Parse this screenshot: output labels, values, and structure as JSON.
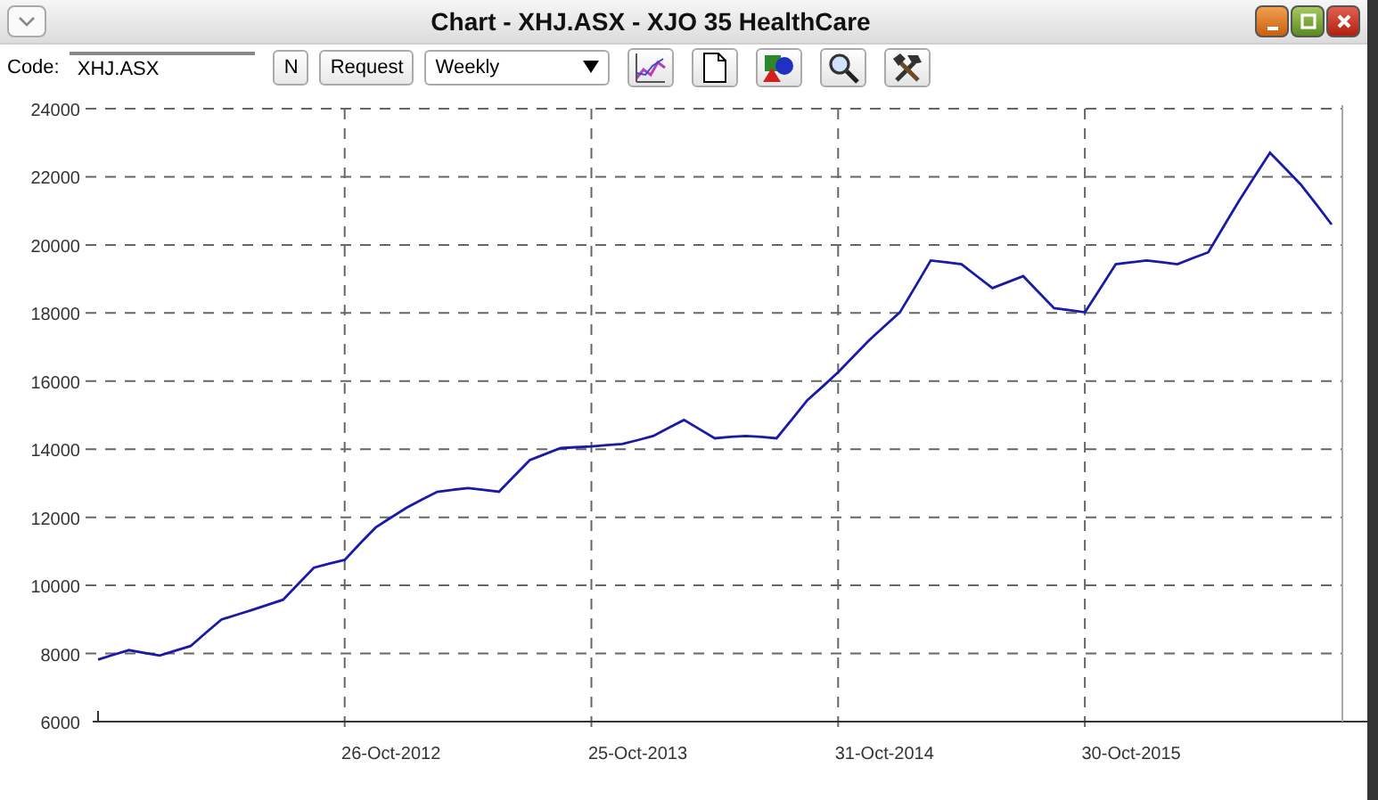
{
  "window": {
    "title": "Chart - XHJ.ASX - XJO 35 HealthCare"
  },
  "toolbar": {
    "code_label": "Code:",
    "code_value": "XHJ.ASX",
    "n_button": "N",
    "request_button": "Request",
    "period": "Weekly"
  },
  "chart": {
    "chart_data": {
      "type": "line",
      "grid": true,
      "ylim": [
        6000,
        24000
      ],
      "yticks": [
        6000,
        8000,
        10000,
        12000,
        14000,
        16000,
        18000,
        20000,
        22000,
        24000
      ],
      "categories": [
        null,
        null,
        null,
        null,
        null,
        null,
        null,
        null,
        null,
        null,
        null,
        null,
        null,
        null,
        null,
        null,
        null,
        null,
        null,
        "26-Oct-2012",
        null,
        null,
        null,
        null,
        null,
        null,
        null,
        null,
        null,
        null,
        null,
        null,
        null,
        null,
        null,
        "25-Oct-2013",
        null,
        null,
        null,
        null,
        null,
        null,
        null,
        null,
        null,
        null,
        null,
        null,
        null,
        null,
        null,
        "31-Oct-2014",
        null,
        null,
        null,
        null,
        null,
        null,
        null,
        null,
        null,
        null,
        null,
        null,
        null,
        null,
        null,
        "30-Oct-2015",
        null,
        null,
        null,
        null,
        null,
        null,
        null,
        null,
        null,
        null,
        null,
        null,
        null
      ],
      "series": [
        {
          "color": "#1a1aa8",
          "values": [
            7820,
            7960,
            8100,
            8020,
            7940,
            8080,
            8220,
            8610,
            9000,
            9140,
            9280,
            9430,
            9580,
            10050,
            10520,
            10640,
            10750,
            11230,
            11700,
            11990,
            12280,
            12520,
            12750,
            12810,
            12860,
            12810,
            12750,
            13220,
            13680,
            13860,
            14030,
            14060,
            14080,
            14120,
            14150,
            14270,
            14390,
            14630,
            14860,
            14590,
            14320,
            14360,
            14390,
            14360,
            14320,
            14880,
            15440,
            15850,
            16260,
            16730,
            17200,
            17610,
            18020,
            18780,
            19540,
            19490,
            19430,
            19080,
            18730,
            18910,
            19080,
            18610,
            18140,
            18080,
            18020,
            18730,
            19430,
            19490,
            19540,
            19490,
            19430,
            19610,
            19780,
            20540,
            21300,
            22010,
            22710,
            22240,
            21770,
            21190,
            20600
          ]
        }
      ]
    }
  }
}
